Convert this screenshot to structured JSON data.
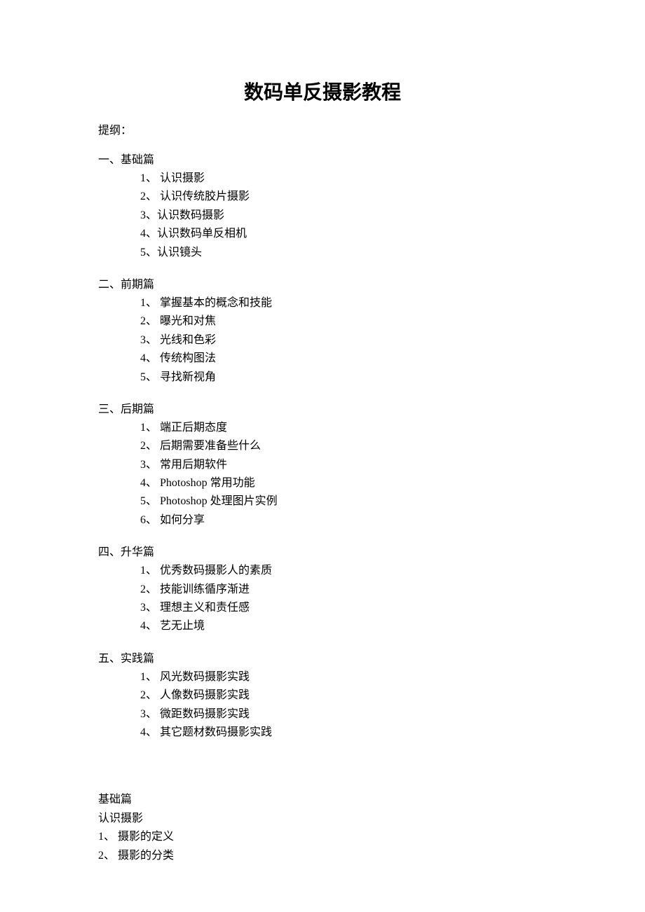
{
  "title": "数码单反摄影教程",
  "outline_label": "提纲：",
  "sections": [
    {
      "heading": "一、基础篇",
      "items": [
        "1、 认识摄影",
        "2、 认识传统胶片摄影",
        "3、认识数码摄影",
        "4、认识数码单反相机",
        "5、认识镜头"
      ]
    },
    {
      "heading": "二、前期篇",
      "items": [
        "1、 掌握基本的概念和技能",
        "2、 曝光和对焦",
        "3、 光线和色彩",
        "4、 传统构图法",
        "5、 寻找新视角"
      ]
    },
    {
      "heading": "三、后期篇",
      "items": [
        "1、 端正后期态度",
        "2、 后期需要准备些什么",
        "3、 常用后期软件",
        "4、 Photoshop 常用功能",
        "5、 Photoshop 处理图片实例",
        "6、 如何分享"
      ]
    },
    {
      "heading": "四、升华篇",
      "items": [
        "1、 优秀数码摄影人的素质",
        "2、 技能训练循序渐进",
        "3、 理想主义和责任感",
        "4、 艺无止境"
      ]
    },
    {
      "heading": "五、实践篇",
      "items": [
        "1、 风光数码摄影实践",
        "2、 人像数码摄影实践",
        "3、 微距数码摄影实践",
        "4、 其它题材数码摄影实践"
      ]
    }
  ],
  "footer": {
    "line1": "基础篇",
    "line2": "认识摄影",
    "items": [
      "1、 摄影的定义",
      "2、 摄影的分类"
    ]
  }
}
